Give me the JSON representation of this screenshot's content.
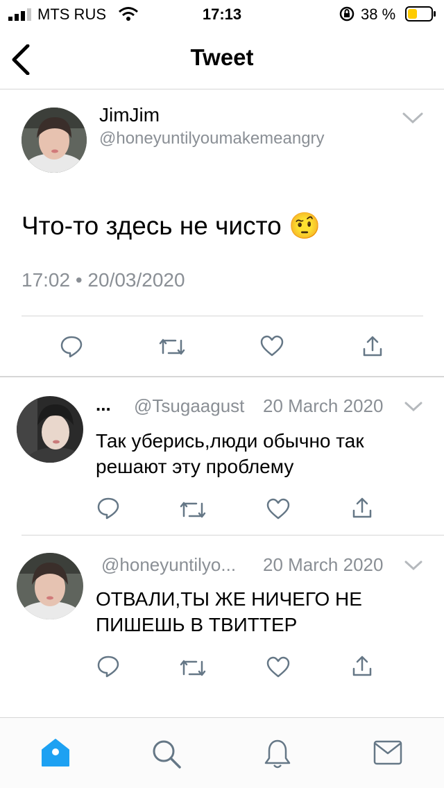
{
  "status_bar": {
    "carrier": "MTS RUS",
    "time": "17:13",
    "battery": "38 %",
    "battery_color": "#ffcc00"
  },
  "header": {
    "title": "Tweet"
  },
  "main_tweet": {
    "name": "JimJim",
    "handle": "@honeyuntilyoumakemeangry",
    "text": "Что-то здесь не чисто",
    "emoji": "🤨",
    "timestamp": "17:02 • 20/03/2020"
  },
  "replies": [
    {
      "name": "...",
      "handle": "@Tsugaagust",
      "date": "20 March 2020",
      "text_lines": [
        "Так уберись,люди обычно так",
        "решают эту проблему"
      ]
    },
    {
      "handle": "@honeyuntilyo...",
      "date": "20 March 2020",
      "text_lines": [
        "ОТВАЛИ,ТЫ ЖЕ НИЧЕГО НЕ",
        "ПИШЕШЬ В ТВИТТЕР"
      ]
    }
  ],
  "tab_bar": {
    "active_color": "#1da1f2",
    "items": [
      "home-icon",
      "search-icon",
      "notifications-icon",
      "messages-icon"
    ]
  },
  "accent_color": "#1da1f2",
  "icon_color": "#657786"
}
